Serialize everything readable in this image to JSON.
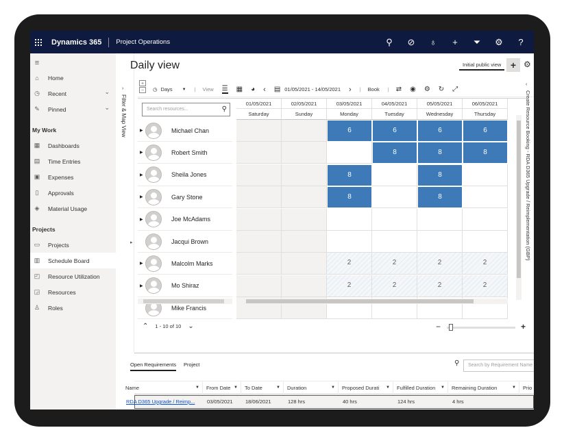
{
  "header": {
    "brand": "Dynamics 365",
    "app": "Project Operations"
  },
  "sidebar": {
    "top": [
      {
        "label": "Home",
        "icon": "home-icon"
      },
      {
        "label": "Recent",
        "icon": "clock-icon"
      },
      {
        "label": "Pinned",
        "icon": "pin-icon"
      }
    ],
    "section1": "My Work",
    "work": [
      "Dashboards",
      "Time Entries",
      "Expenses",
      "Approvals",
      "Material Usage"
    ],
    "section2": "Projects",
    "projects": [
      "Projects",
      "Schedule Board",
      "Resource Utilization",
      "Resources",
      "Roles"
    ]
  },
  "filter_strip": "Filter & Map View",
  "page": {
    "title": "Daily view",
    "view_button": "Initial public view"
  },
  "toolbar": {
    "unit": "Days",
    "view_label": "View",
    "date_range": "01/05/2021 - 14/05/2021",
    "book_label": "Book"
  },
  "search": {
    "placeholder": "Search resources..."
  },
  "days": [
    {
      "date": "01/05/2021",
      "day": "Saturday"
    },
    {
      "date": "02/05/2021",
      "day": "Sunday"
    },
    {
      "date": "03/05/2021",
      "day": "Monday"
    },
    {
      "date": "04/05/2021",
      "day": "Tuesday"
    },
    {
      "date": "05/05/2021",
      "day": "Wednesday"
    },
    {
      "date": "06/05/2021",
      "day": "Thursday"
    }
  ],
  "resources": [
    {
      "name": "Michael Chan",
      "expand": true,
      "hours": [
        "",
        "",
        "6",
        "6",
        "6",
        "6"
      ],
      "kind": [
        "off",
        "off",
        "blue",
        "blue",
        "blue",
        "blue"
      ]
    },
    {
      "name": "Robert Smith",
      "expand": true,
      "hours": [
        "",
        "",
        "",
        "8",
        "8",
        "8"
      ],
      "kind": [
        "off",
        "off",
        "",
        "blue",
        "blue",
        "blue"
      ]
    },
    {
      "name": "Sheila Jones",
      "expand": true,
      "hours": [
        "",
        "",
        "8",
        "",
        "8",
        ""
      ],
      "kind": [
        "off",
        "off",
        "blue",
        "",
        "blue",
        ""
      ]
    },
    {
      "name": "Gary Stone",
      "expand": true,
      "hours": [
        "",
        "",
        "8",
        "",
        "8",
        ""
      ],
      "kind": [
        "off",
        "off",
        "blue",
        "",
        "blue",
        ""
      ]
    },
    {
      "name": "Joe McAdams",
      "expand": true,
      "hours": [
        "",
        "",
        "",
        "",
        "",
        ""
      ],
      "kind": [
        "off",
        "off",
        "",
        "",
        "",
        ""
      ]
    },
    {
      "name": "Jacqui Brown",
      "expand": false,
      "hours": [
        "",
        "",
        "",
        "",
        "",
        ""
      ],
      "kind": [
        "off",
        "off",
        "",
        "",
        "",
        ""
      ]
    },
    {
      "name": "Malcolm Marks",
      "expand": true,
      "hours": [
        "",
        "",
        "2",
        "2",
        "2",
        "2"
      ],
      "kind": [
        "off",
        "off",
        "hatch",
        "hatch",
        "hatch",
        "hatch"
      ]
    },
    {
      "name": "Mo Shiraz",
      "expand": true,
      "hours": [
        "",
        "",
        "2",
        "2",
        "2",
        "2"
      ],
      "kind": [
        "off",
        "off",
        "hatch",
        "hatch",
        "hatch",
        "hatch"
      ]
    },
    {
      "name": "Mike Francis",
      "expand": false,
      "hours": [
        "",
        "",
        "",
        "",
        "",
        ""
      ],
      "kind": [
        "off",
        "off",
        "",
        "",
        "",
        ""
      ]
    }
  ],
  "pager": "1 - 10 of 10",
  "side_panel": "Create Resource Booking - RDA D365 Upgrade / Reimplementation (GBP)",
  "requirements": {
    "tabs": [
      "Open Requirements",
      "Project"
    ],
    "search_placeholder": "Search by Requirement Name",
    "columns": [
      "Name",
      "From Date",
      "To Date",
      "Duration",
      "Proposed Durati",
      "Fulfilled Duration",
      "Remaining Duration",
      "Prio"
    ],
    "rows": [
      {
        "name": "RDA D365 Upgrade / Reimp...",
        "from": "03/05/2021",
        "to": "18/06/2021",
        "duration": "128 hrs",
        "proposed": "40 hrs",
        "fulfilled": "124 hrs",
        "remaining": "4 hrs"
      }
    ]
  },
  "colors": {
    "topbar": "#0e1a3f",
    "booking": "#3e79b8",
    "sidebar": "#f3f2f1"
  }
}
